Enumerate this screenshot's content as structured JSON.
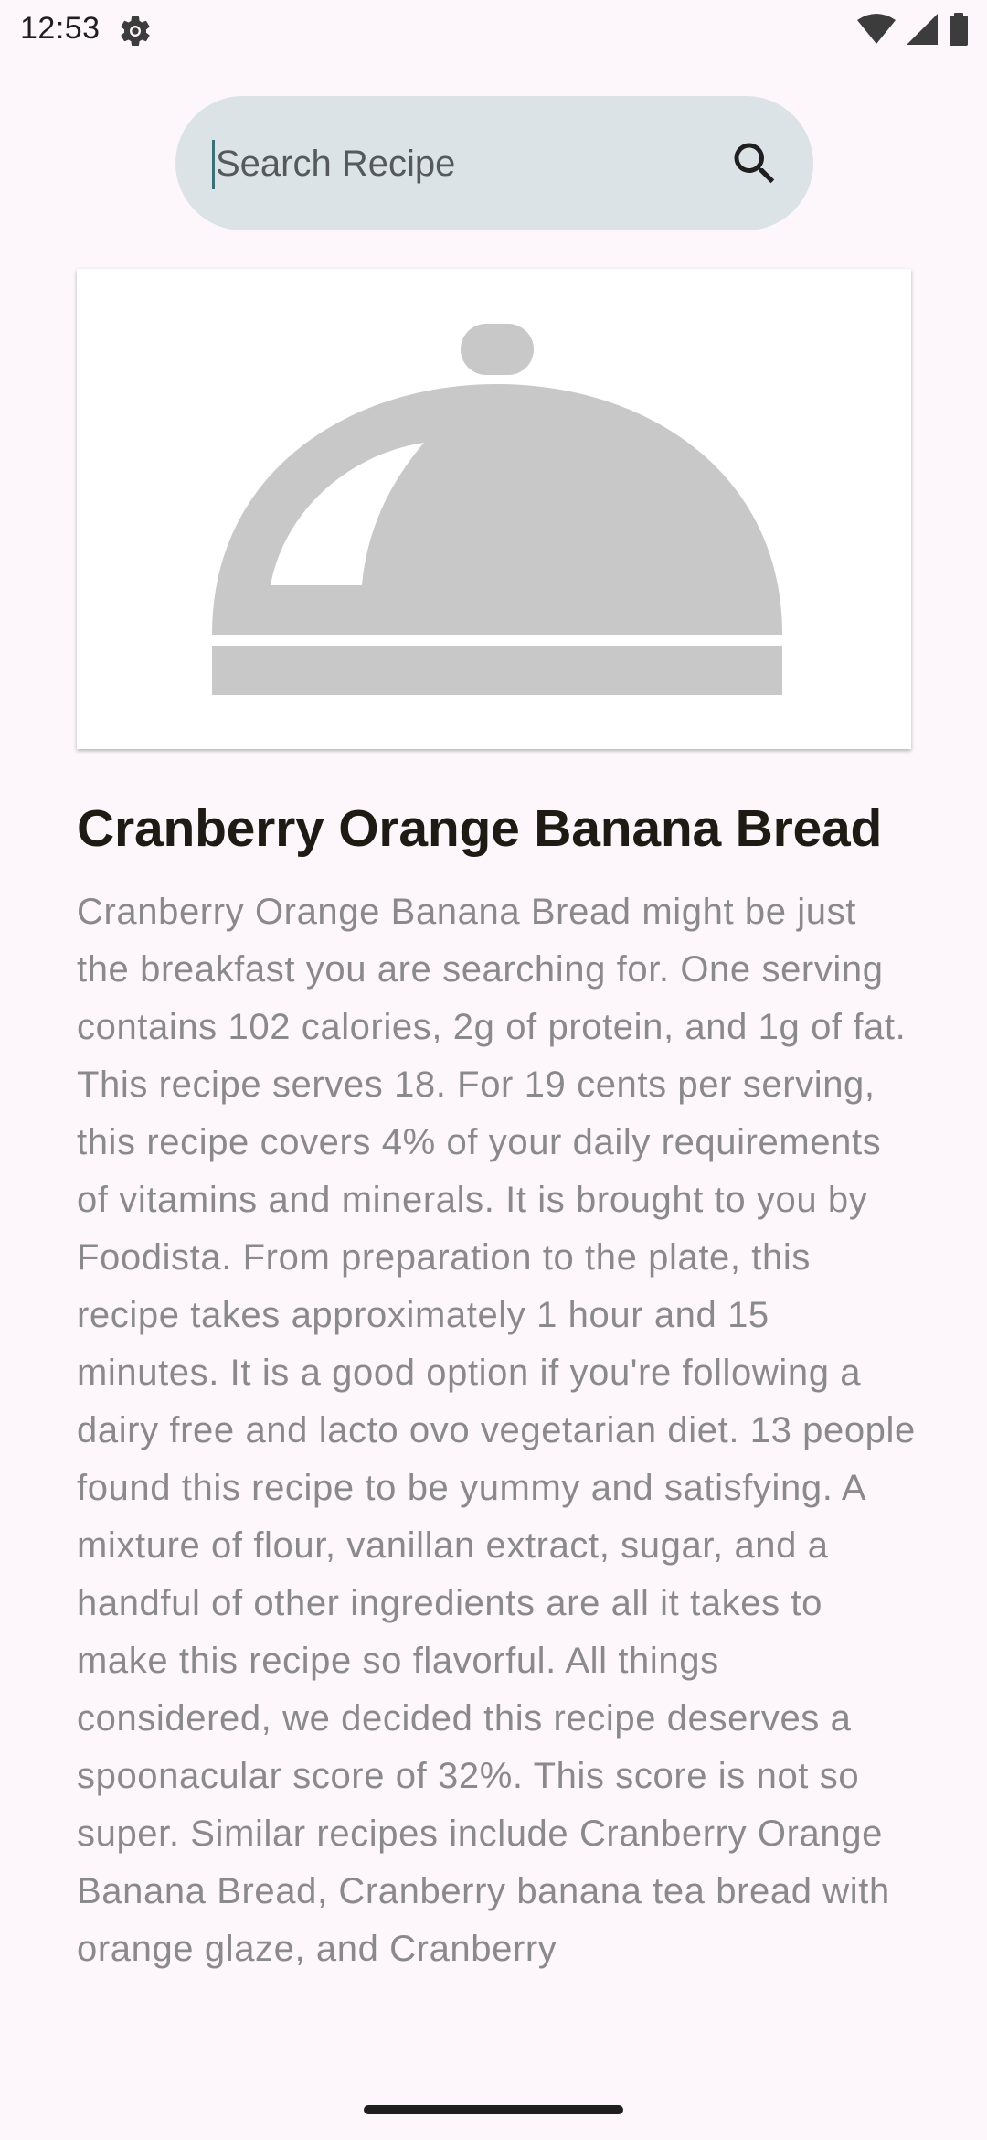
{
  "status_bar": {
    "time": "12:53",
    "icons": [
      "settings-gear-icon",
      "wifi-icon",
      "cellular-signal-icon",
      "battery-icon"
    ]
  },
  "search": {
    "placeholder": "Search Recipe",
    "value": "",
    "icon": "search-icon"
  },
  "recipe": {
    "image_icon": "food-cloche-placeholder-icon",
    "title": "Cranberry Orange Banana Bread",
    "description": "Cranberry Orange Banana Bread might be just the breakfast you are searching for. One serving contains 102 calories, 2g of protein, and 1g of fat. This recipe serves 18. For 19 cents per serving, this recipe covers 4% of your daily requirements of vitamins and minerals. It is brought to you by Foodista. From preparation to the plate, this recipe takes approximately 1 hour and 15 minutes. It is a good option if you're following a dairy free and lacto ovo vegetarian diet. 13 people found this recipe to be yummy and satisfying. A mixture of flour, vanillan extract, sugar, and a handful of other ingredients are all it takes to make this recipe so flavorful. All things considered, we decided this recipe deserves a spoonacular score of 32%. This score is not so super. Similar recipes include Cranberry Orange Banana Bread, Cranberry banana tea bread with orange glaze, and Cranberry"
  },
  "colors": {
    "background": "#fdf7fb",
    "search_bar": "#dbe3e6",
    "cursor": "#3b6f78",
    "title": "#1d1b13",
    "description": "#8a8a8a",
    "placeholder_icon": "#c8c8c8"
  }
}
